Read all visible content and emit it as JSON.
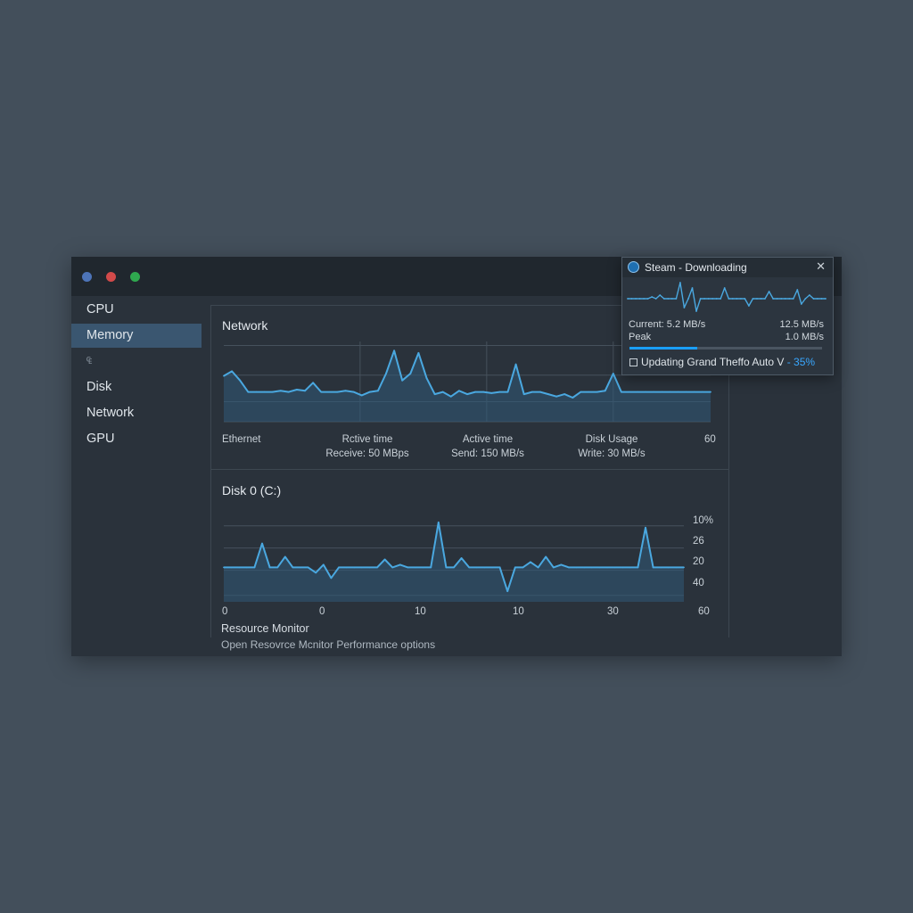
{
  "sidebar": {
    "items": [
      {
        "label": "CPU",
        "active": false
      },
      {
        "label": "Memory",
        "active": true
      },
      {
        "label": "₠",
        "active": false,
        "small": true
      },
      {
        "label": "Disk",
        "active": false
      },
      {
        "label": "Network",
        "active": false
      },
      {
        "label": "GPU",
        "active": false
      }
    ]
  },
  "network": {
    "title": "Network",
    "axis_end": "60",
    "columns": [
      {
        "heading": "Ethernet",
        "value": ""
      },
      {
        "heading": "Rctive time",
        "value": "Receive: 50 MBps"
      },
      {
        "heading": "Active time",
        "value": "Send: 150 MB/s"
      },
      {
        "heading": "Disk Usage",
        "value": "Write: 30 MB/s"
      }
    ]
  },
  "disk": {
    "title": "Disk 0 (C:)",
    "y_ticks": [
      "10%",
      "26",
      "20",
      "40"
    ],
    "x_ticks": [
      "0",
      "0",
      "10",
      "10",
      "30",
      "60"
    ]
  },
  "footer": {
    "title": "Resource Monitor",
    "link": "Open Resovrce Mcnitor Performance options"
  },
  "steam": {
    "title": "Steam - Downloading",
    "close": "✕",
    "current_label": "Current: 5.2 MB/s",
    "current_value": "12.5 MB/s",
    "peak_label": "Peak",
    "peak_value": "1.0 MB/s",
    "progress": 0.35,
    "status_text": "Updating Grand Theffo Auto V",
    "status_pct": "- 35%"
  },
  "colors": {
    "accent": "#1a9fff",
    "line": "#4aa8e0",
    "fill": "#2f5a78"
  },
  "chart_data": [
    {
      "type": "line",
      "title": "Network",
      "x": [
        0,
        1,
        2,
        3,
        4,
        5,
        6,
        7,
        8,
        9,
        10,
        11,
        12,
        13,
        14,
        15,
        16,
        17,
        18,
        19,
        20,
        21,
        22,
        23,
        24,
        25,
        26,
        27,
        28,
        29,
        30,
        31,
        32,
        33,
        34,
        35,
        36,
        37,
        38,
        39,
        40,
        41,
        42,
        43,
        44,
        45,
        46,
        47,
        48,
        49,
        50,
        51,
        52,
        53,
        54,
        55,
        56,
        57,
        58,
        59,
        60
      ],
      "values": [
        40,
        44,
        36,
        26,
        26,
        26,
        26,
        27,
        26,
        28,
        27,
        34,
        26,
        26,
        26,
        27,
        26,
        23,
        26,
        27,
        42,
        62,
        36,
        42,
        60,
        38,
        24,
        26,
        22,
        27,
        24,
        26,
        26,
        25,
        26,
        26,
        50,
        24,
        26,
        26,
        24,
        22,
        24,
        21,
        26,
        26,
        26,
        27,
        42,
        26,
        26,
        26,
        26,
        26,
        26,
        26,
        26,
        26,
        26,
        26,
        26
      ],
      "ylim": [
        0,
        70
      ]
    },
    {
      "type": "line",
      "title": "Disk 0 (C:)",
      "x": [
        0,
        1,
        2,
        3,
        4,
        5,
        6,
        7,
        8,
        9,
        10,
        11,
        12,
        13,
        14,
        15,
        16,
        17,
        18,
        19,
        20,
        21,
        22,
        23,
        24,
        25,
        26,
        27,
        28,
        29,
        30,
        31,
        32,
        33,
        34,
        35,
        36,
        37,
        38,
        39,
        40,
        41,
        42,
        43,
        44,
        45,
        46,
        47,
        48,
        49,
        50,
        51,
        52,
        53,
        54,
        55,
        56,
        57,
        58,
        59,
        60
      ],
      "values": [
        26,
        26,
        26,
        26,
        26,
        44,
        26,
        26,
        34,
        26,
        26,
        26,
        22,
        28,
        18,
        26,
        26,
        26,
        26,
        26,
        26,
        32,
        26,
        28,
        26,
        26,
        26,
        26,
        60,
        26,
        26,
        33,
        26,
        26,
        26,
        26,
        26,
        8,
        26,
        26,
        30,
        26,
        34,
        26,
        28,
        26,
        26,
        26,
        26,
        26,
        26,
        26,
        26,
        26,
        26,
        56,
        26,
        26,
        26,
        26,
        26
      ],
      "ylim": [
        0,
        70
      ]
    },
    {
      "type": "line",
      "title": "Steam - Downloading",
      "x": [
        0,
        1,
        2,
        3,
        4,
        5,
        6,
        7,
        8,
        9,
        10,
        11,
        12,
        13,
        14,
        15,
        16,
        17,
        18,
        19,
        20,
        21,
        22,
        23,
        24,
        25,
        26,
        27,
        28,
        29,
        30,
        31,
        32,
        33,
        34,
        35,
        36,
        37,
        38,
        39,
        40,
        41,
        42,
        43,
        44,
        45,
        46,
        47,
        48,
        49
      ],
      "values": [
        20,
        20,
        20,
        20,
        20,
        20,
        22,
        20,
        24,
        20,
        20,
        20,
        20,
        38,
        10,
        20,
        32,
        6,
        20,
        20,
        20,
        20,
        20,
        20,
        32,
        20,
        20,
        20,
        20,
        20,
        12,
        20,
        20,
        20,
        20,
        28,
        20,
        20,
        20,
        20,
        20,
        20,
        30,
        14,
        20,
        24,
        20,
        20,
        20,
        20
      ],
      "ylim": [
        0,
        42
      ]
    }
  ]
}
